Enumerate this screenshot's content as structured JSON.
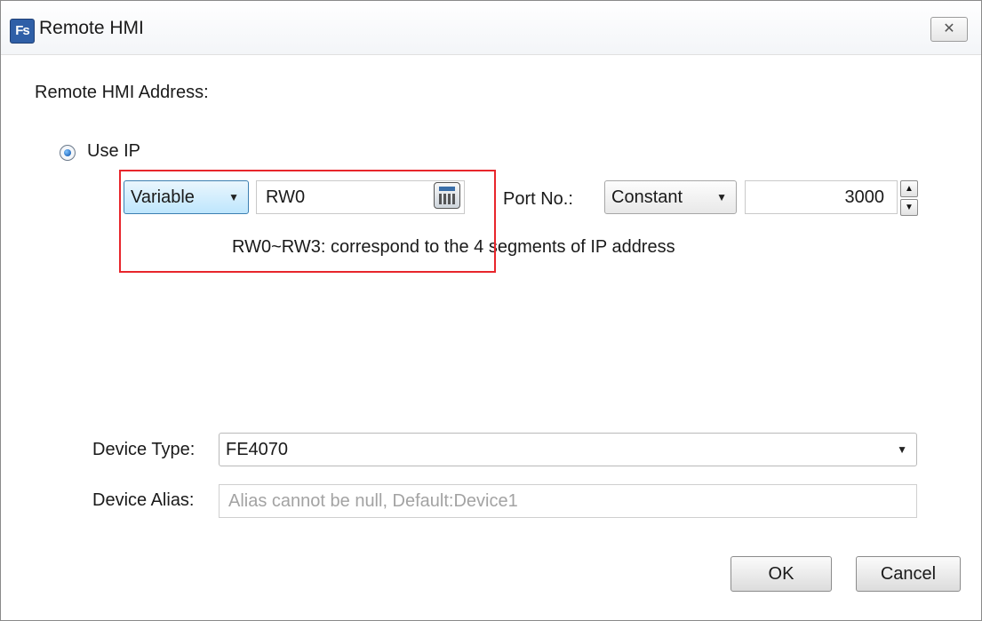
{
  "window": {
    "title": "Remote HMI",
    "app_icon_text": "Fs",
    "close_glyph": "✕"
  },
  "section_label": "Remote HMI Address:",
  "use_ip": {
    "label": "Use IP",
    "selected": true
  },
  "ip_address": {
    "mode_value": "Variable",
    "variable_value": "RW0",
    "hint": "RW0~RW3: correspond to the 4 segments of IP address"
  },
  "port": {
    "label": "Port No.:",
    "mode_value": "Constant",
    "value": "3000"
  },
  "device": {
    "type_label": "Device Type:",
    "type_value": "FE4070",
    "alias_label": "Device Alias:",
    "alias_placeholder": "Alias cannot be null, Default:Device1"
  },
  "buttons": {
    "ok_label": "OK",
    "cancel_label": "Cancel"
  },
  "colors": {
    "highlight": "#e8262c",
    "active_combo": "#bee6fd"
  }
}
